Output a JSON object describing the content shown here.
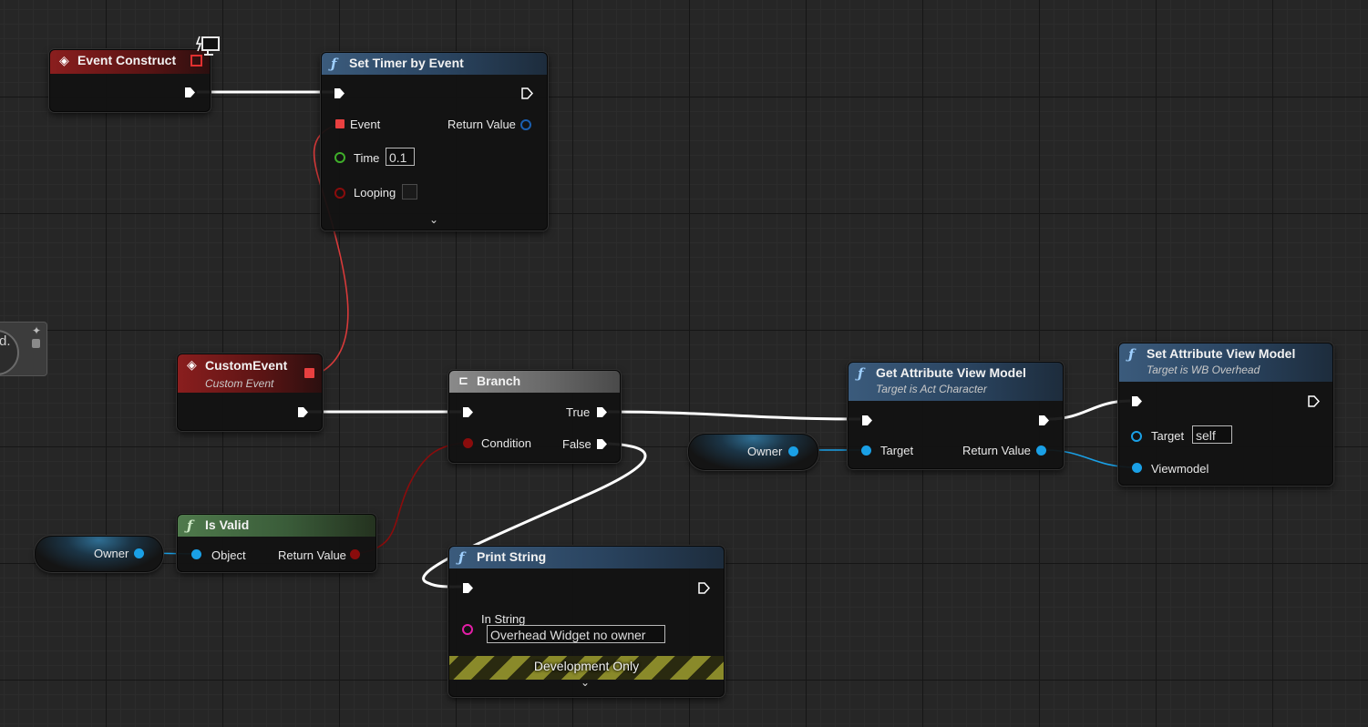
{
  "nodes": {
    "event_construct": {
      "title": "Event Construct"
    },
    "set_timer": {
      "title": "Set Timer by Event",
      "pins": {
        "event": "Event",
        "time": "Time",
        "looping": "Looping",
        "return": "Return Value"
      },
      "time_value": "0.1"
    },
    "custom_event": {
      "title": "CustomEvent",
      "subtitle": "Custom Event"
    },
    "branch": {
      "title": "Branch",
      "pins": {
        "condition": "Condition",
        "true": "True",
        "false": "False"
      }
    },
    "is_valid": {
      "title": "Is Valid",
      "pins": {
        "object": "Object",
        "return": "Return Value"
      }
    },
    "owner_var_1": {
      "label": "Owner"
    },
    "owner_var_2": {
      "label": "Owner"
    },
    "get_attr_vm": {
      "title": "Get Attribute View Model",
      "subtitle": "Target is Act Character",
      "pins": {
        "target": "Target",
        "return": "Return Value"
      }
    },
    "set_attr_vm": {
      "title": "Set Attribute View Model",
      "subtitle": "Target is WB Overhead",
      "pins": {
        "target": "Target",
        "viewmodel": "Viewmodel"
      },
      "target_value": "self"
    },
    "print_string": {
      "title": "Print String",
      "pins": {
        "in_string": "In String"
      },
      "in_string_value": "Overhead Widget no owner",
      "dev_only": "Development Only"
    },
    "ghost_partial": {
      "text": "d."
    }
  },
  "colors": {
    "exec_wire": "#ffffff",
    "event_wire": "#d83a3a",
    "bool_wire": "#8a0c0c",
    "object_wire": "#1aa0e6"
  },
  "icons": [
    "event-diamond-icon",
    "function-icon",
    "branch-icon",
    "network-monitor-icon",
    "pin-icon",
    "chevron-down-icon"
  ]
}
